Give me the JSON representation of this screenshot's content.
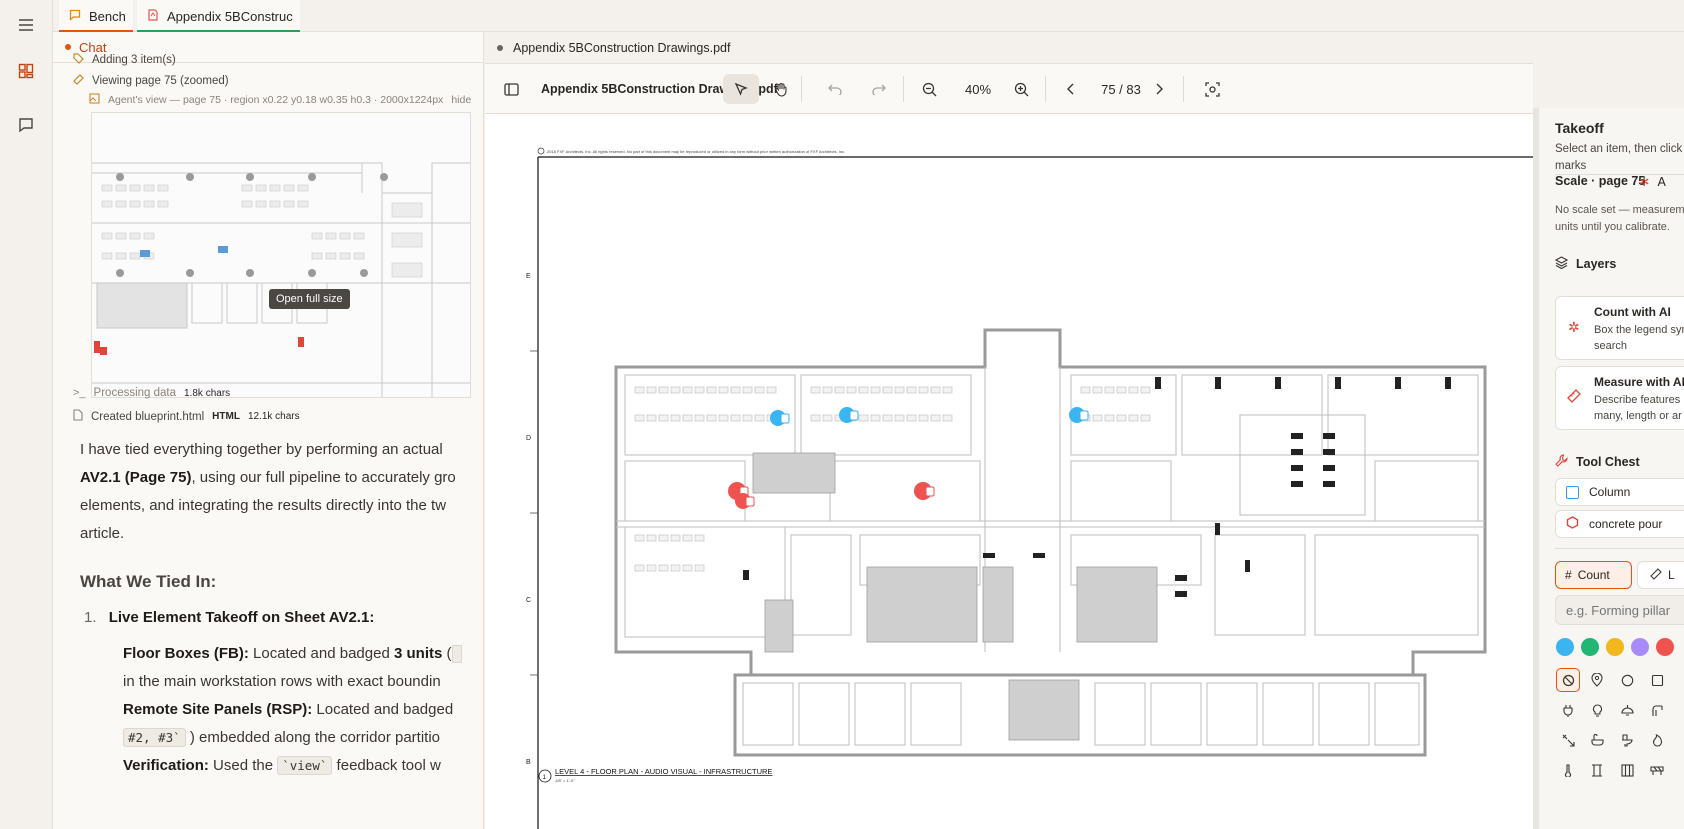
{
  "tabs": [
    {
      "label": "Bench",
      "icon": "chat-bubble-icon"
    },
    {
      "label": "Appendix 5BConstruc",
      "icon": "pdf-icon"
    }
  ],
  "chat": {
    "title": "Chat",
    "steps": {
      "adding": "Adding 3 item(s)",
      "viewing": "Viewing page 75 (zoomed)",
      "agent_view": "Agent's view — page 75 · region x0.22 y0.18 w0.35 h0.3 · 2000x1224px",
      "hide": "hide",
      "open_full": "Open full size",
      "processing": "Processing data",
      "processing_size": "1.8k chars",
      "created": "Created blueprint.html",
      "created_type": "HTML",
      "created_size": "12.1k chars"
    },
    "message": {
      "p1_line1": "I have tied everything together by performing an actual",
      "p1_line2_bold": "AV2.1 (Page 75)",
      "p1_line2_rest": ", using our full pipeline to accurately gro",
      "p1_line3": "elements, and integrating the results directly into the tw",
      "p1_line4": "article.",
      "heading": "What We Tied In:",
      "item1_num": "1.",
      "item1": "Live Element Takeoff on Sheet AV2.1:",
      "b1_bold": "Floor Boxes (FB):",
      "b1_rest": " Located and badged ",
      "b1_count": "3 units",
      "b1_tail": " (",
      "b1_line2": "in the main workstation rows with exact boundin",
      "b2_bold": "Remote Site Panels (RSP):",
      "b2_rest": " Located and badged",
      "b2_code": "#2, #3`",
      "b2_line2": " ) embedded along the corridor partitio",
      "b3_bold": "Verification:",
      "b3_rest": " Used the ",
      "b3_code": "`view`",
      "b3_tail": " feedback tool w"
    }
  },
  "viewer": {
    "file_name": "Appendix 5BConstruction Drawings.pdf",
    "toolbar_title": "Appendix 5BConstruction Drawings.pdf",
    "zoom": "40%",
    "page": "75 / 83",
    "sheet_title": "LEVEL 4 - FLOOR PLAN - AUDIO VISUAL - INFRASTRUCTURE",
    "sheet_scale": "1/8\" = 1'-0\"",
    "sheet_num": "1",
    "copyright": "2018 FXF Architects, Inc. All rights reserved. No part of this document may be reproduced or utilized in any form without prior written authorization of FXF Architects, Inc.",
    "grid": [
      "E",
      "D",
      "C",
      "B"
    ]
  },
  "takeoff": {
    "title": "Takeoff",
    "subtitle_l1": "Select an item, then click",
    "subtitle_l2": "marks",
    "scale_tab": "Scale · page 75",
    "ai_tab": "A",
    "scale_note_l1": "No scale set — measureme",
    "scale_note_l2": "units until you calibrate.",
    "layers": "Layers",
    "count_ai": {
      "title": "Count with AI",
      "d1": "Box the legend sym",
      "d2": "search"
    },
    "measure_ai": {
      "title": "Measure with AI",
      "d1": "Describe features",
      "d2": "many, length or ar"
    },
    "tool_chest": "Tool Chest",
    "items": [
      {
        "label": "Column",
        "color": "#3b9be8"
      },
      {
        "label": "concrete pour",
        "color": "#e0453a"
      }
    ],
    "mode_count": "Count",
    "mode_length": "L",
    "input_placeholder": "e.g. Forming pillar",
    "swatches": [
      "#3bb4f2",
      "#22b573",
      "#f2b61f",
      "#a78bfa",
      "#ef5350"
    ]
  }
}
